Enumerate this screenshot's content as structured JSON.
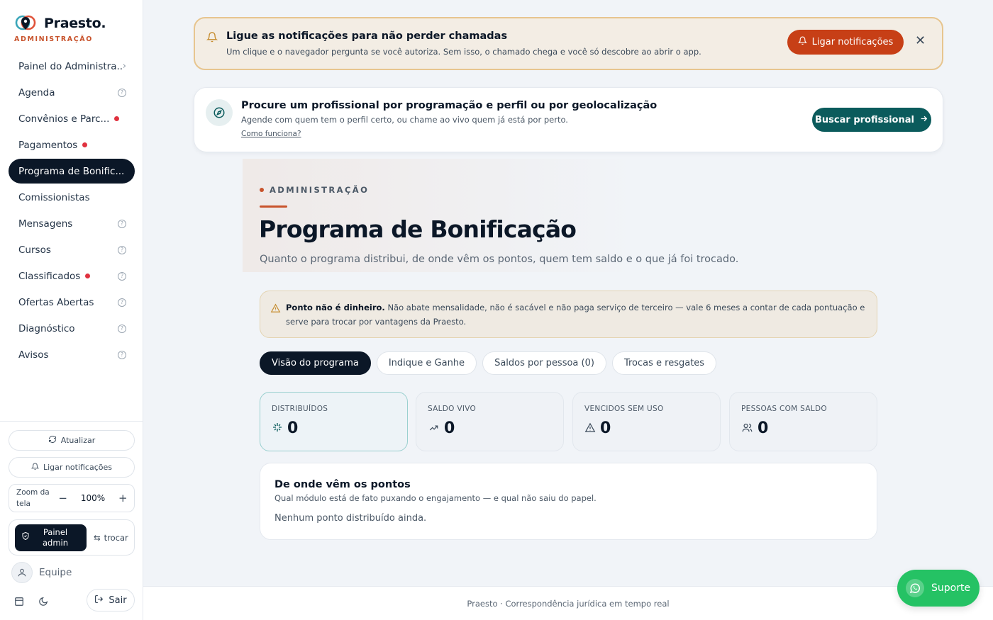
{
  "brand": {
    "name": "Praesto.",
    "subtitle": "ADMINISTRAÇÃO"
  },
  "sidebar": {
    "items": [
      {
        "label": "Painel do Administra...",
        "indicator": "chevron"
      },
      {
        "label": "Agenda",
        "indicator": "help"
      },
      {
        "label": "Convênios e Parc...",
        "indicator": "dot"
      },
      {
        "label": "Pagamentos",
        "indicator": "dot"
      },
      {
        "label": "Programa de Bonific...",
        "indicator": "none",
        "active": true
      },
      {
        "label": "Comissionistas",
        "indicator": "none"
      },
      {
        "label": "Mensagens",
        "indicator": "help"
      },
      {
        "label": "Cursos",
        "indicator": "help"
      },
      {
        "label": "Classificados",
        "indicator": "dot+help"
      },
      {
        "label": "Ofertas Abertas",
        "indicator": "help"
      },
      {
        "label": "Diagnóstico",
        "indicator": "help"
      },
      {
        "label": "Avisos",
        "indicator": "help"
      }
    ],
    "refresh_label": "Atualizar",
    "notify_label": "Ligar notificações",
    "zoom": {
      "label": "Zoom da tela",
      "value": "100%",
      "minus": "−",
      "plus": "+"
    },
    "role": {
      "admin_label": "Painel admin",
      "switch_label": "trocar"
    },
    "team_label": "Equipe",
    "logout_label": "Sair"
  },
  "notification_banner": {
    "title": "Ligue as notificações para não perder chamadas",
    "text": "Um clique e o navegador pergunta se você autoriza. Sem isso, o chamado chega e você só descobre ao abrir o app.",
    "button_label": "Ligar notificações",
    "close_label": "✕"
  },
  "search_card": {
    "title": "Procure um profissional por programação e perfil ou por geolocalização",
    "text": "Agende com quem tem o perfil certo, ou chame ao vivo quem já está por perto.",
    "link": "Como funciona?",
    "button_label": "Buscar profissional"
  },
  "page": {
    "eyebrow": "ADMINISTRAÇÃO",
    "title": "Programa de Bonificação",
    "subtitle": "Quanto o programa distribui, de onde vêm os pontos, quem tem saldo e o que já foi trocado."
  },
  "warning": {
    "bold": "Ponto não é dinheiro.",
    "text": " Não abate mensalidade, não é sacável e não paga serviço de terceiro — vale 6 meses a contar de cada pontuação e serve para trocar por vantagens da Praesto."
  },
  "tabs": [
    {
      "label": "Visão do programa",
      "active": true
    },
    {
      "label": "Indique e Ganhe"
    },
    {
      "label": "Saldos por pessoa (0)"
    },
    {
      "label": "Trocas e resgates"
    }
  ],
  "stats": [
    {
      "label": "DISTRIBUÍDOS",
      "value": "0",
      "icon": "sparkles-icon"
    },
    {
      "label": "SALDO VIVO",
      "value": "0",
      "icon": "trending-up-icon"
    },
    {
      "label": "VENCIDOS SEM USO",
      "value": "0",
      "icon": "warning-icon"
    },
    {
      "label": "PESSOAS COM SALDO",
      "value": "0",
      "icon": "users-icon"
    }
  ],
  "sources": {
    "title": "De onde vêm os pontos",
    "subtitle": "Qual módulo está de fato puxando o engajamento — e qual não saiu do papel.",
    "empty": "Nenhum ponto distribuído ainda."
  },
  "footer": {
    "text": "Praesto · Correspondência jurídica em tempo real"
  },
  "support": {
    "label": "Suporte"
  },
  "colors": {
    "accent": "#c8532c",
    "dark": "#0b1727",
    "teal": "#0b5b5c",
    "alert_button": "#c73f16",
    "whatsapp": "#25c264",
    "dot": "#e0323f"
  }
}
